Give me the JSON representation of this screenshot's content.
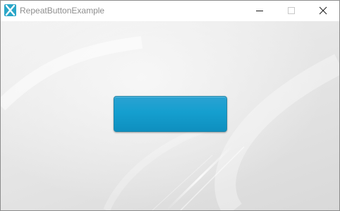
{
  "window": {
    "title": "RepeatButtonExample",
    "icon": "java-fx-icon",
    "controls": {
      "minimize": "minimize-icon",
      "maximize": "maximize-icon",
      "close": "close-icon"
    }
  },
  "main": {
    "repeat_button": {
      "label": "",
      "color": "#159fcf"
    }
  },
  "colors": {
    "accent": "#159fcf",
    "app_icon": "#29a6c8"
  }
}
